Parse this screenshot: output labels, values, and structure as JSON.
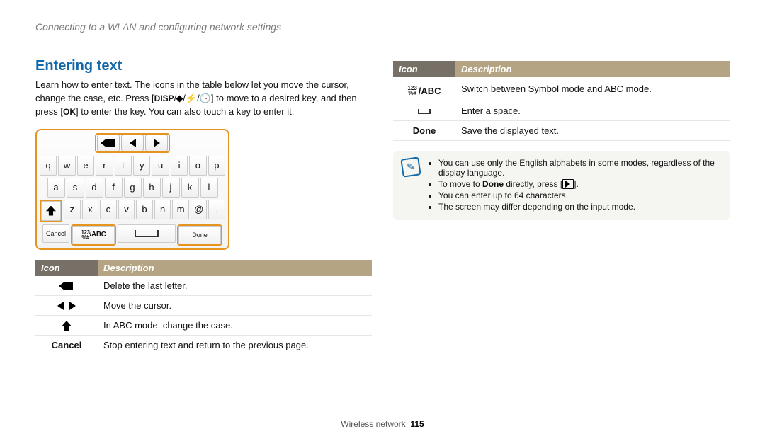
{
  "breadcrumb": "Connecting to a WLAN and configuring network settings",
  "section_title": "Entering text",
  "intro_1": "Learn how to enter text. The icons in the table below let you move the cursor, change the case, etc. Press [",
  "intro_disp": "DISP",
  "intro_2": "] to move to a desired key, and then press [",
  "intro_ok": "OK",
  "intro_3": "] to enter the key. You can also touch a key to enter it.",
  "kbd": {
    "row1": [
      "q",
      "w",
      "e",
      "r",
      "t",
      "y",
      "u",
      "i",
      "o",
      "p"
    ],
    "row2": [
      "a",
      "s",
      "d",
      "f",
      "g",
      "h",
      "j",
      "k",
      "l"
    ],
    "row3": [
      "z",
      "x",
      "c",
      "v",
      "b",
      "n",
      "m",
      "@",
      "."
    ],
    "cancel": "Cancel",
    "mode_sym_top": "123",
    "mode_sym_bot": "%#",
    "mode_abc": "/ABC",
    "done": "Done"
  },
  "th_icon": "Icon",
  "th_desc": "Description",
  "left_table": [
    {
      "icon_html": "backspace",
      "desc": "Delete the last letter."
    },
    {
      "icon_html": "leftright",
      "desc": "Move the cursor."
    },
    {
      "icon_html": "shift",
      "desc": "In ABC mode, change the case."
    },
    {
      "icon_html": "Cancel",
      "desc": "Stop entering text and return to the previous page."
    }
  ],
  "right_table": [
    {
      "icon_html": "modeabc",
      "desc": "Switch between Symbol mode and ABC mode."
    },
    {
      "icon_html": "space",
      "desc": "Enter a space."
    },
    {
      "icon_html": "Done",
      "desc": "Save the displayed text."
    }
  ],
  "notes": {
    "n1": "You can use only the English alphabets in some modes, regardless of the display language.",
    "n2a": "To move to ",
    "n2b": "Done",
    "n2c": " directly, press [",
    "n2d": "].",
    "n3": "You can enter up to 64 characters.",
    "n4": "The screen may differ depending on the input mode."
  },
  "footer_section": "Wireless network",
  "footer_page": "115"
}
